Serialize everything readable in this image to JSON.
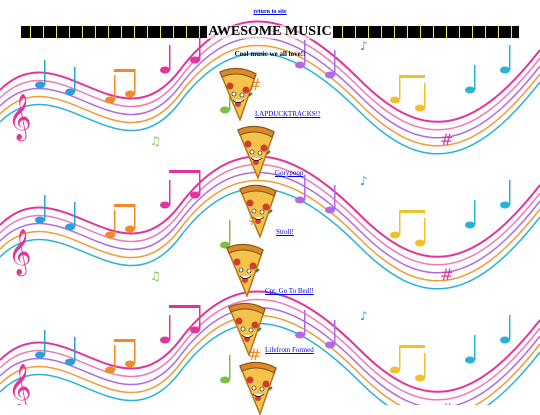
{
  "nav": {
    "return_label": "return to site"
  },
  "header": {
    "title": "AWESOME MUSIC",
    "subtitle": "Cool music we all love!!"
  },
  "tracks": [
    {
      "label": "LAPDUCKTRACKS!!"
    },
    {
      "label": "Gorypoop"
    },
    {
      "label": "Stroll!"
    },
    {
      "label": "Cpt. Go To Bed!!"
    },
    {
      "label": "Lifefrom Formed"
    }
  ],
  "colors": {
    "link": "#0000ee",
    "banner": "#000000",
    "banner_accent": "#f5e36a"
  },
  "icons": {
    "track_icon": "pizza-slice-icon"
  }
}
